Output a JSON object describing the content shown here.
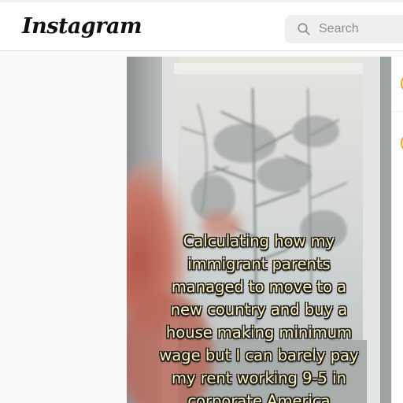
{
  "header": {
    "logo_text": "Instagram",
    "search_placeholder": "Search"
  },
  "post": {
    "caption_lines": [
      "Calculating how my",
      "immigrant parents",
      "managed to move to a",
      "new country and buy a",
      "house making minimum",
      "wage but I can barely pay",
      "my rent working 9-5 in",
      "corporate America"
    ]
  },
  "colors": {
    "caption_text": "#fff3b8",
    "story_ring": "#f5a623",
    "search_bg": "#efefef"
  },
  "icons": {
    "search": "search-icon",
    "avatar": "avatar"
  }
}
